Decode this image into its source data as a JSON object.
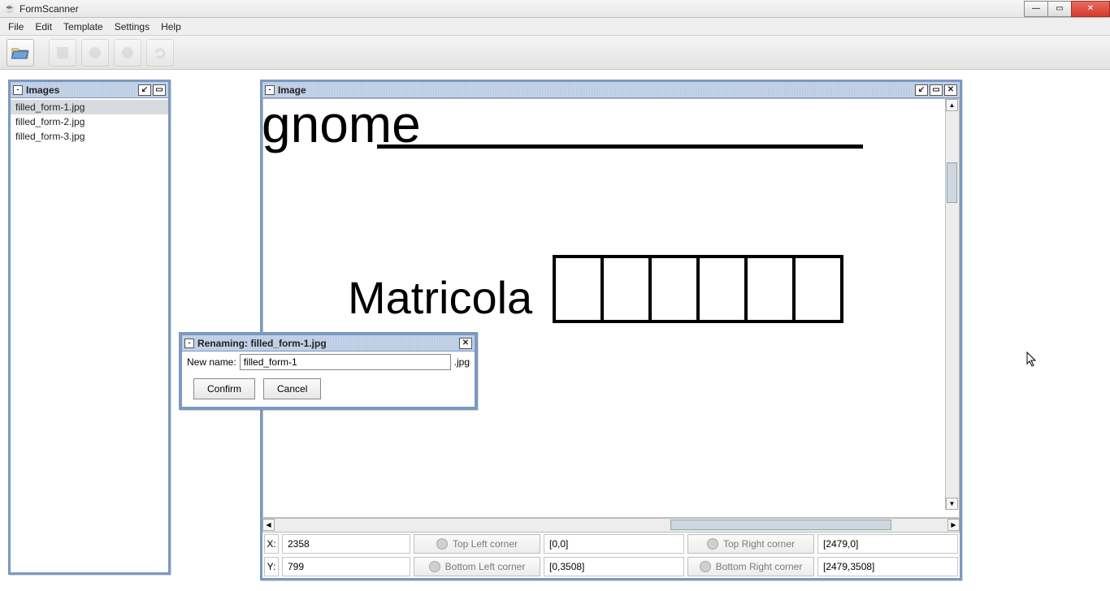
{
  "app": {
    "title": "FormScanner"
  },
  "menus": {
    "file": "File",
    "edit": "Edit",
    "template": "Template",
    "settings": "Settings",
    "help": "Help"
  },
  "panels": {
    "images": {
      "title": "Images",
      "items": [
        "filled_form-1.jpg",
        "filled_form-2.jpg",
        "filled_form-3.jpg"
      ],
      "selected_index": 0
    },
    "image": {
      "title": "Image"
    }
  },
  "document": {
    "heading": "gnome",
    "label": "Matricola"
  },
  "status": {
    "x_label": "X:",
    "x_value": "2358",
    "y_label": "Y:",
    "y_value": "799",
    "top_left_btn": "Top Left corner",
    "top_left_val": "[0,0]",
    "top_right_btn": "Top Right corner",
    "top_right_val": "[2479,0]",
    "bottom_left_btn": "Bottom Left corner",
    "bottom_left_val": "[0,3508]",
    "bottom_right_btn": "Bottom Right corner",
    "bottom_right_val": "[2479,3508]"
  },
  "rename": {
    "title": "Renaming: filled_form-1.jpg",
    "new_name_label": "New name:",
    "value": "filled_form-1",
    "ext": ".jpg",
    "confirm": "Confirm",
    "cancel": "Cancel"
  }
}
